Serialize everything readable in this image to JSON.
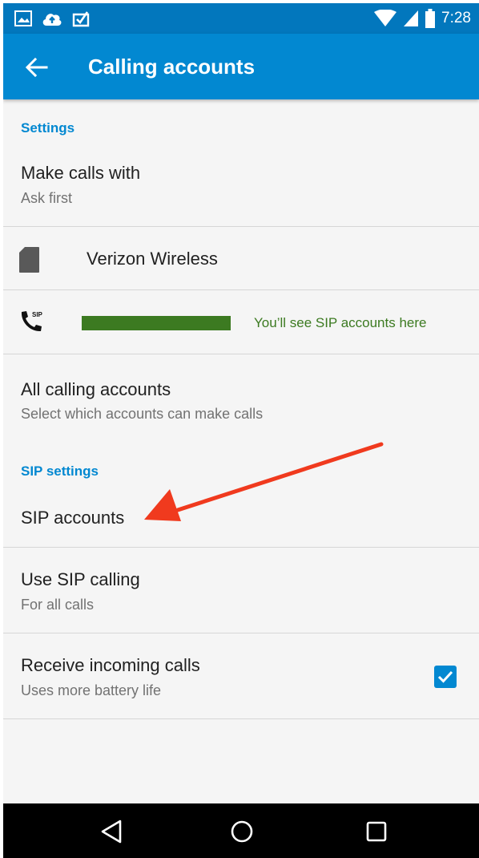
{
  "status_bar": {
    "time": "7:28",
    "left_icons": [
      "image-icon",
      "cloud-upload-icon",
      "clipboard-check-icon"
    ],
    "right_icons": [
      "wifi-icon",
      "signal-icon",
      "battery-icon"
    ]
  },
  "app_bar": {
    "title": "Calling accounts",
    "back_icon": "arrow-back-icon",
    "color": "#0288d1"
  },
  "sections": {
    "settings_header": "Settings",
    "sip_header": "SIP settings"
  },
  "rows": {
    "make_calls": {
      "title": "Make calls with",
      "subtitle": "Ask first"
    },
    "verizon": {
      "title": "Verizon Wireless",
      "icon": "sim-card-icon"
    },
    "sip_account": {
      "note": "You’ll see SIP accounts here",
      "icon": "sip-phone-icon"
    },
    "all_accounts": {
      "title": "All calling accounts",
      "subtitle": "Select which accounts can make calls"
    },
    "sip_accounts": {
      "title": "SIP accounts"
    },
    "use_sip": {
      "title": "Use SIP calling",
      "subtitle": "For all calls"
    },
    "receive_calls": {
      "title": "Receive incoming calls",
      "subtitle": "Uses more battery life",
      "checked": true
    }
  },
  "annotation": {
    "arrow_color": "#f03a1e"
  },
  "nav_bar": {
    "icons": [
      "back-triangle-icon",
      "home-circle-icon",
      "recents-square-icon"
    ]
  }
}
